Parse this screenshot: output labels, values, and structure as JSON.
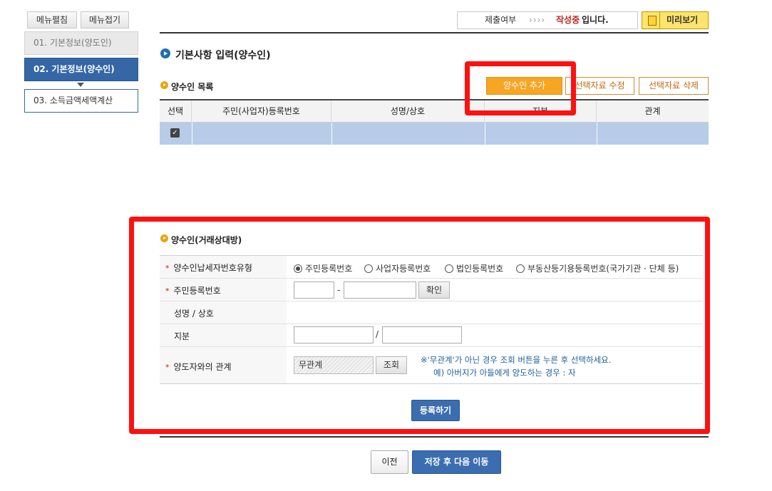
{
  "sidebar": {
    "edit_menu": "메뉴펼침",
    "fold_menu": "메뉴접기",
    "items": [
      {
        "label": "01. 기본정보(양도인)",
        "state": "done"
      },
      {
        "label": "02. 기본정보(양수인)",
        "state": "active"
      },
      {
        "label": "03. 소득금액세액계산",
        "state": "next"
      }
    ]
  },
  "status": {
    "label": "제출여부",
    "arrows": "››››",
    "value": "작성중",
    "suffix": "입니다.",
    "preview": "미리보기"
  },
  "section": {
    "title": "기본사항 입력(양수인)",
    "list_title": "양수인 목록",
    "buttons": {
      "add": "양수인 추가",
      "edit": "선택자료 수정",
      "delete": "선택자료 삭제"
    },
    "columns": [
      "선택",
      "주민(사업자)등록번호",
      "성명/상호",
      "지분",
      "관계"
    ],
    "rows": [
      {
        "checked": true,
        "id": "",
        "name": "",
        "share": "",
        "relation": ""
      }
    ]
  },
  "form": {
    "title": "양수인(거래상대방)",
    "fields": {
      "type_label": "양수인납세자번호유형",
      "id_label": "주민등록번호",
      "name_label": "성명 / 상호",
      "share_label": "지분",
      "relation_label": "양도자와의 관계"
    },
    "type_options": [
      "주민등록번호",
      "사업자등록번호",
      "법인등록번호",
      "부동산등기용등록번호(국가기관 · 단체 등)"
    ],
    "selected_type": 0,
    "id_dash": "-",
    "confirm_btn": "확인",
    "share_slash": "/",
    "relation_value": "무관계",
    "lookup_btn": "조회",
    "note_line1": "※'무관계'가 아닌 경우 조회 버튼을 누른 후 선택하세요.",
    "note_line2": "예) 아버지가 아들에게 양도하는 경우 : 자",
    "register_btn": "등록하기"
  },
  "footer": {
    "prev": "이전",
    "save_next": "저장 후 다음 이동"
  },
  "colors": {
    "primary_blue": "#3567a6",
    "highlight_red": "#ff1010",
    "orange": "#f6a623",
    "selected_row": "#b8cce9"
  }
}
